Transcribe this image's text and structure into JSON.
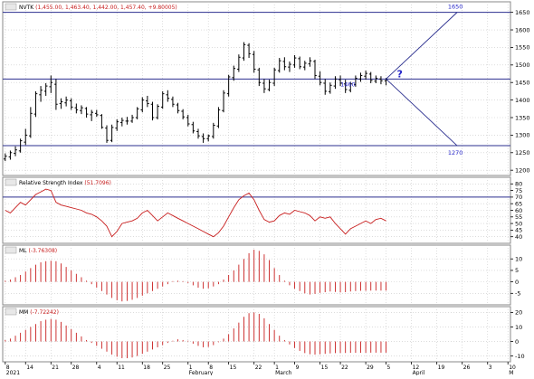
{
  "colors": {
    "panel_bg": "#ffffff",
    "frame": "#8a8a8a",
    "grid": "#c8c8c8",
    "bar": "#000000",
    "level": "#2b2f8f",
    "level_text": "#2323c8",
    "rsi": "#c81e1e",
    "osc": "#c81e1e",
    "header_bg": "#ffffff",
    "header_value": "#c81e1e"
  },
  "chart_data": [
    {
      "type": "ohlc",
      "header_label": "NVTK",
      "header_value": "(1,455.00, 1,463.40, 1,442.00, 1,457.40, +9.80005)",
      "ylim": [
        1185,
        1680
      ],
      "yticks": [
        1200,
        1250,
        1300,
        1350,
        1400,
        1450,
        1500,
        1550,
        1600,
        1650
      ],
      "levels": [
        {
          "y": 1650,
          "label": ""
        },
        {
          "y": 1460,
          "label": "1460"
        },
        {
          "y": 1270,
          "label": ""
        }
      ],
      "projection": {
        "from_index": 75,
        "from_y": 1460,
        "to_index": 89,
        "up_y": 1650,
        "down_y": 1270,
        "up_label": "1650",
        "down_label": "1270",
        "question": "?"
      },
      "bars": [
        [
          1232,
          1248,
          1226,
          1240
        ],
        [
          1238,
          1256,
          1230,
          1250
        ],
        [
          1248,
          1268,
          1240,
          1258
        ],
        [
          1255,
          1290,
          1250,
          1284
        ],
        [
          1280,
          1318,
          1272,
          1300
        ],
        [
          1298,
          1380,
          1292,
          1362
        ],
        [
          1360,
          1425,
          1352,
          1418
        ],
        [
          1415,
          1440,
          1395,
          1428
        ],
        [
          1425,
          1448,
          1412,
          1440
        ],
        [
          1438,
          1470,
          1420,
          1450
        ],
        [
          1445,
          1460,
          1372,
          1388
        ],
        [
          1390,
          1405,
          1375,
          1395
        ],
        [
          1392,
          1410,
          1382,
          1400
        ],
        [
          1398,
          1405,
          1372,
          1380
        ],
        [
          1378,
          1390,
          1362,
          1372
        ],
        [
          1370,
          1385,
          1360,
          1378
        ],
        [
          1376,
          1380,
          1350,
          1360
        ],
        [
          1358,
          1372,
          1340,
          1365
        ],
        [
          1362,
          1372,
          1352,
          1358
        ],
        [
          1356,
          1360,
          1318,
          1322
        ],
        [
          1320,
          1328,
          1278,
          1285
        ],
        [
          1285,
          1330,
          1280,
          1322
        ],
        [
          1320,
          1345,
          1312,
          1338
        ],
        [
          1336,
          1350,
          1325,
          1342
        ],
        [
          1340,
          1352,
          1330,
          1340
        ],
        [
          1340,
          1358,
          1335,
          1350
        ],
        [
          1350,
          1380,
          1345,
          1375
        ],
        [
          1372,
          1408,
          1365,
          1400
        ],
        [
          1398,
          1412,
          1380,
          1390
        ],
        [
          1388,
          1395,
          1342,
          1350
        ],
        [
          1350,
          1388,
          1345,
          1382
        ],
        [
          1380,
          1425,
          1375,
          1418
        ],
        [
          1415,
          1428,
          1395,
          1405
        ],
        [
          1402,
          1410,
          1380,
          1388
        ],
        [
          1386,
          1392,
          1362,
          1370
        ],
        [
          1368,
          1374,
          1345,
          1352
        ],
        [
          1350,
          1358,
          1325,
          1332
        ],
        [
          1330,
          1338,
          1305,
          1312
        ],
        [
          1310,
          1318,
          1290,
          1298
        ],
        [
          1296,
          1305,
          1278,
          1290
        ],
        [
          1290,
          1302,
          1282,
          1298
        ],
        [
          1296,
          1335,
          1290,
          1328
        ],
        [
          1326,
          1380,
          1320,
          1372
        ],
        [
          1370,
          1428,
          1365,
          1420
        ],
        [
          1418,
          1472,
          1410,
          1466
        ],
        [
          1464,
          1498,
          1455,
          1490
        ],
        [
          1488,
          1530,
          1480,
          1522
        ],
        [
          1520,
          1565,
          1512,
          1558
        ],
        [
          1556,
          1562,
          1520,
          1532
        ],
        [
          1530,
          1540,
          1478,
          1488
        ],
        [
          1486,
          1492,
          1440,
          1450
        ],
        [
          1448,
          1460,
          1420,
          1432
        ],
        [
          1430,
          1458,
          1425,
          1450
        ],
        [
          1448,
          1492,
          1440,
          1486
        ],
        [
          1484,
          1520,
          1478,
          1512
        ],
        [
          1510,
          1522,
          1485,
          1495
        ],
        [
          1494,
          1510,
          1480,
          1502
        ],
        [
          1500,
          1528,
          1492,
          1520
        ],
        [
          1518,
          1524,
          1488,
          1495
        ],
        [
          1494,
          1512,
          1485,
          1505
        ],
        [
          1503,
          1522,
          1495,
          1512
        ],
        [
          1510,
          1515,
          1460,
          1470
        ],
        [
          1468,
          1482,
          1442,
          1450
        ],
        [
          1448,
          1460,
          1415,
          1425
        ],
        [
          1424,
          1450,
          1418,
          1442
        ],
        [
          1440,
          1468,
          1432,
          1460
        ],
        [
          1458,
          1470,
          1440,
          1448
        ],
        [
          1446,
          1458,
          1420,
          1430
        ],
        [
          1428,
          1452,
          1422,
          1446
        ],
        [
          1444,
          1470,
          1438,
          1462
        ],
        [
          1460,
          1478,
          1452,
          1470
        ],
        [
          1468,
          1484,
          1458,
          1476
        ],
        [
          1474,
          1480,
          1448,
          1456
        ],
        [
          1454,
          1470,
          1448,
          1462
        ],
        [
          1460,
          1468,
          1445,
          1455
        ],
        [
          1455,
          1463,
          1442,
          1457
        ]
      ]
    },
    {
      "type": "line",
      "header_label": "Relative Strength Index",
      "header_value": "(51.7096)",
      "ylim": [
        35,
        85
      ],
      "yticks": [
        40,
        45,
        50,
        55,
        60,
        65,
        70,
        75,
        80
      ],
      "levels": [
        70
      ],
      "values": [
        60,
        58,
        62,
        66,
        64,
        68,
        72,
        74,
        76,
        75,
        66,
        64,
        63,
        62,
        61,
        60,
        58,
        57,
        55,
        52,
        48,
        40,
        44,
        50,
        51,
        52,
        54,
        58,
        60,
        56,
        52,
        55,
        58,
        56,
        54,
        52,
        50,
        48,
        46,
        44,
        42,
        40,
        43,
        48,
        55,
        62,
        68,
        71,
        73,
        68,
        60,
        53,
        51,
        52,
        56,
        58,
        57,
        60,
        59,
        58,
        56,
        52,
        55,
        54,
        55,
        50,
        46,
        42,
        46,
        48,
        50,
        52,
        50,
        53,
        54,
        52
      ]
    },
    {
      "type": "bar",
      "header_label": "ML",
      "header_value": "(-3.76308)",
      "ylim": [
        -10,
        16
      ],
      "yticks": [
        -5,
        0,
        5,
        10
      ],
      "values": [
        0.5,
        1,
        2,
        3,
        4.5,
        6,
        7.5,
        8.5,
        9,
        9.2,
        9,
        8,
        6.5,
        5,
        3.5,
        2,
        0.5,
        -1,
        -2.5,
        -4,
        -5.5,
        -7,
        -8,
        -8.5,
        -8.3,
        -7.8,
        -7,
        -6,
        -5,
        -4,
        -3,
        -2,
        -1,
        0,
        0.5,
        0.2,
        -0.5,
        -1.5,
        -2.5,
        -3,
        -2.8,
        -2,
        -1,
        1,
        3,
        5,
        7.5,
        10,
        12.5,
        14,
        13.5,
        12,
        9.5,
        6,
        3,
        0.5,
        -1.5,
        -3,
        -4,
        -5,
        -5.5,
        -5.2,
        -4.8,
        -4.5,
        -4.2,
        -4.4,
        -4.6,
        -4.5,
        -4.2,
        -4,
        -3.9,
        -3.9,
        -3.8,
        -3.8,
        -3.8,
        -3.8
      ]
    },
    {
      "type": "bar",
      "header_label": "MM",
      "header_value": "(-7.72242)",
      "ylim": [
        -14,
        24
      ],
      "yticks": [
        -10,
        0,
        10,
        20
      ],
      "values": [
        1,
        2,
        4,
        6,
        8,
        10,
        12,
        14,
        15,
        15.5,
        15,
        13.5,
        11,
        8.5,
        6,
        3.5,
        1,
        -1,
        -3,
        -5,
        -7,
        -9,
        -10.5,
        -11.5,
        -11.5,
        -11,
        -10,
        -8.5,
        -7,
        -5.5,
        -4,
        -2.5,
        -1,
        0.5,
        1.5,
        1,
        0,
        -1.5,
        -3,
        -4,
        -3.8,
        -2.5,
        -0.5,
        2,
        5,
        9,
        13,
        17,
        19.5,
        20,
        19,
        16,
        12,
        8,
        4,
        1,
        -2,
        -4.5,
        -6.5,
        -8,
        -8.8,
        -9,
        -8.8,
        -8.5,
        -8.2,
        -8,
        -7.9,
        -7.9,
        -7.8,
        -7.8,
        -7.8,
        -7.8,
        -7.7,
        -7.7,
        -7.7,
        -7.7
      ]
    }
  ],
  "xaxis": {
    "total_slots": 100,
    "ticks": [
      {
        "index": 0,
        "label": "8"
      },
      {
        "index": 4,
        "label": "14"
      },
      {
        "index": 9,
        "label": "21"
      },
      {
        "index": 13,
        "label": "28"
      },
      {
        "index": 18,
        "label": "4"
      },
      {
        "index": 22,
        "label": "11"
      },
      {
        "index": 27,
        "label": "18"
      },
      {
        "index": 31,
        "label": "25"
      },
      {
        "index": 36,
        "label": "1"
      },
      {
        "index": 40,
        "label": "8"
      },
      {
        "index": 44,
        "label": "15"
      },
      {
        "index": 49,
        "label": "22"
      },
      {
        "index": 53,
        "label": "1"
      },
      {
        "index": 57,
        "label": "9"
      },
      {
        "index": 62,
        "label": "15"
      },
      {
        "index": 66,
        "label": "22"
      },
      {
        "index": 71,
        "label": "29"
      },
      {
        "index": 75,
        "label": "5"
      },
      {
        "index": 80,
        "label": "12"
      },
      {
        "index": 85,
        "label": "19"
      },
      {
        "index": 90,
        "label": "26"
      },
      {
        "index": 95,
        "label": "3"
      },
      {
        "index": 99,
        "label": "10"
      }
    ],
    "month_labels": [
      {
        "index": 0,
        "label": "2021"
      },
      {
        "index": 36,
        "label": "February"
      },
      {
        "index": 53,
        "label": "March"
      },
      {
        "index": 80,
        "label": "April"
      },
      {
        "index": 99,
        "label": "M"
      }
    ]
  }
}
